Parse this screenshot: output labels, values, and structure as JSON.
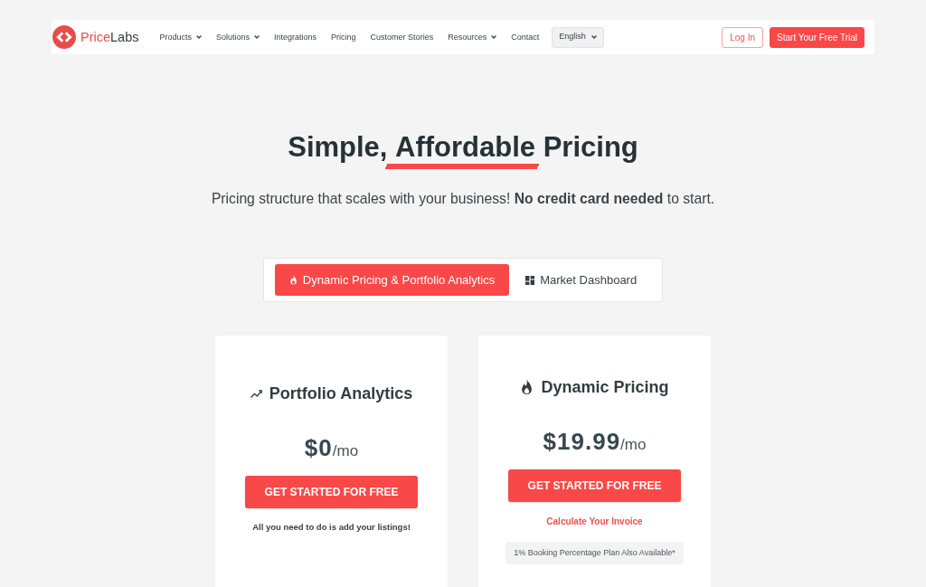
{
  "navbar": {
    "logo": {
      "text_primary": "Price",
      "text_secondary": "Labs"
    },
    "links": [
      {
        "label": "Products",
        "has_menu": true
      },
      {
        "label": "Solutions",
        "has_menu": true
      },
      {
        "label": "Integrations",
        "has_menu": false
      },
      {
        "label": "Pricing",
        "has_menu": false
      },
      {
        "label": "Customer Stories",
        "has_menu": false
      },
      {
        "label": "Resources",
        "has_menu": true
      },
      {
        "label": "Contact",
        "has_menu": false
      }
    ],
    "language": {
      "value": "English"
    },
    "actions": [
      {
        "label": "Log In",
        "kind": "outline"
      },
      {
        "label": "Start Your Free Trial",
        "kind": "filled"
      }
    ]
  },
  "hero": {
    "title": {
      "before": "Simple, ",
      "underlined_text": "Affordable",
      "after": " Pricing"
    },
    "subtitle": "Pricing structure that scales with your business! **No credit card needed** to start."
  },
  "tabs": [
    {
      "label": "Dynamic Pricing & Portfolio Analytics",
      "selected": true
    },
    {
      "label": "Market Dashboard",
      "selected": false
    }
  ],
  "plans": [
    {
      "title": "Portfolio Analytics",
      "price": "$0",
      "period": "/mo",
      "button": "GET STARTED FOR FREE",
      "note": "All you need to do is add your listings!"
    },
    {
      "title": "Dynamic Pricing",
      "price": "$19.99",
      "period": "/mo",
      "button": "GET STARTED FOR FREE",
      "link": "Calculate Your Invoice",
      "badge": "1% Booking Percentage Plan Also Available*"
    }
  ]
}
